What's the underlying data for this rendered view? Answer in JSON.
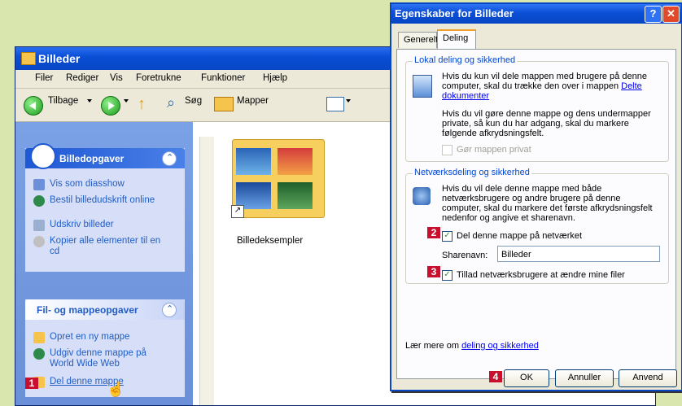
{
  "explorer": {
    "title": "Billeder",
    "menu": [
      "Filer",
      "Rediger",
      "Vis",
      "Foretrukne",
      "Funktioner",
      "Hjælp"
    ],
    "toolbar": {
      "back": "Tilbage",
      "search": "Søg",
      "folders": "Mapper"
    },
    "picture_tasks": {
      "title": "Billedopgaver",
      "items": [
        "Vis som diasshow",
        "Bestil billedudskrift online",
        "Udskriv billeder",
        "Kopier alle elementer til en cd"
      ]
    },
    "file_tasks": {
      "title": "Fil- og mappeopgaver",
      "items": [
        "Opret en ny mappe",
        "Udgiv denne mappe på World Wide Web",
        "Del denne mappe"
      ]
    },
    "folder_name": "Billedeksempler",
    "step1": "1"
  },
  "dialog": {
    "title": "Egenskaber for Billeder",
    "tabs": [
      "Generelt",
      "Deling"
    ],
    "local": {
      "heading": "Lokal deling og sikkerhed",
      "text1": "Hvis du kun vil dele mappen med brugere på denne computer, skal du trække den over i mappen",
      "link": "Delte dokumenter",
      "text2": "Hvis du vil gøre denne mappe og dens undermapper private, så kun du har adgang, skal du markere følgende afkrydsningsfelt.",
      "private_label": "Gør mappen privat"
    },
    "network": {
      "heading": "Netværksdeling og sikkerhed",
      "text": "Hvis du vil dele denne mappe med både netværksbrugere og andre brugere på denne computer, skal du markere det første afkrydsningsfelt nedenfor og angive et sharenavn.",
      "share_label": "Del denne mappe på netværket",
      "sharename_label": "Sharenavn:",
      "sharename_value": "Billeder",
      "allow_label": "Tillad netværksbrugere at ændre mine filer"
    },
    "learn_prefix": "Lær mere om",
    "learn_link": "deling og sikkerhed",
    "buttons": {
      "ok": "OK",
      "cancel": "Annuller",
      "apply": "Anvend"
    },
    "steps": [
      "2",
      "3",
      "4"
    ]
  }
}
